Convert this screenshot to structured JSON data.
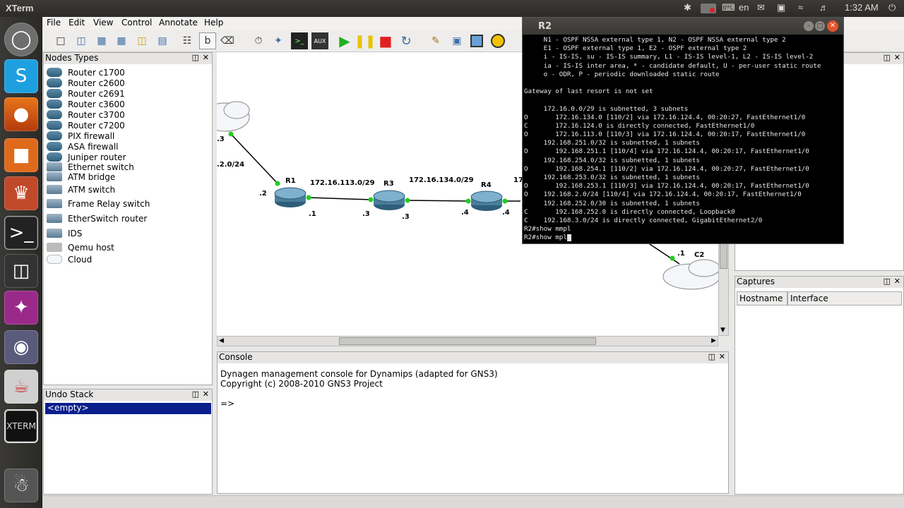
{
  "topbar": {
    "app_title": "XTerm",
    "language": "en",
    "time": "1:32 AM"
  },
  "menu": [
    "File",
    "Edit",
    "View",
    "Control",
    "Annotate",
    "Help"
  ],
  "nodes_panel": {
    "title": "Nodes Types",
    "items": [
      "Router c1700",
      "Router c2600",
      "Router c2691",
      "Router c3600",
      "Router c3700",
      "Router c7200",
      "PIX firewall",
      "ASA firewall",
      "Juniper router",
      "Ethernet switch",
      "ATM bridge",
      "ATM switch",
      "Frame Relay switch",
      "EtherSwitch router",
      "IDS",
      "Qemu host",
      "Cloud"
    ]
  },
  "undo_panel": {
    "title": "Undo Stack",
    "item": "<empty>"
  },
  "topology": {
    "routers": [
      "R1",
      "R3",
      "R4"
    ],
    "cloud": "C2",
    "networks": [
      "172.16.113.0/29",
      "172.16.134.0/29",
      ".2.0/24",
      "17"
    ],
    "iface_labels": [
      ".3",
      ".2",
      ".1",
      ".3",
      ".3",
      ".4",
      ".4",
      ".1"
    ]
  },
  "terminal": {
    "title": "R2",
    "lines": [
      "     N1 - OSPF NSSA external type 1, N2 - OSPF NSSA external type 2",
      "     E1 - OSPF external type 1, E2 - OSPF external type 2",
      "     i - IS-IS, su - IS-IS summary, L1 - IS-IS level-1, L2 - IS-IS level-2",
      "     ia - IS-IS inter area, * - candidate default, U - per-user static route",
      "     o - ODR, P - periodic downloaded static route",
      "",
      "Gateway of last resort is not set",
      "",
      "     172.16.0.0/29 is subnetted, 3 subnets",
      "O       172.16.134.0 [110/2] via 172.16.124.4, 00:20:27, FastEthernet1/0",
      "C       172.16.124.0 is directly connected, FastEthernet1/0",
      "O       172.16.113.0 [110/3] via 172.16.124.4, 00:20:17, FastEthernet1/0",
      "     192.168.251.0/32 is subnetted, 1 subnets",
      "O       192.168.251.1 [110/4] via 172.16.124.4, 00:20:17, FastEthernet1/0",
      "     192.168.254.0/32 is subnetted, 1 subnets",
      "O       192.168.254.1 [110/2] via 172.16.124.4, 00:20:27, FastEthernet1/0",
      "     192.168.253.0/32 is subnetted, 1 subnets",
      "O       192.168.253.1 [110/3] via 172.16.124.4, 00:20:17, FastEthernet1/0",
      "O    192.168.2.0/24 [110/4] via 172.16.124.4, 00:20:17, FastEthernet1/0",
      "     192.168.252.0/30 is subnetted, 1 subnets",
      "C       192.168.252.0 is directly connected, Loopback0",
      "C    192.168.3.0/24 is directly connected, GigabitEthernet2/0",
      "R2#show mmpl",
      "R2#show mpl"
    ]
  },
  "console": {
    "title": "Console",
    "lines": [
      "Dynagen management console for Dynamips (adapted for GNS3)",
      "Copyright (c) 2008-2010 GNS3 Project",
      "",
      "=>"
    ]
  },
  "captures": {
    "title": "Captures",
    "columns": [
      "Hostname",
      "Interface"
    ]
  },
  "colors": {
    "link_dot": "#22cc22",
    "selection": "#0a1f8c",
    "terminal_bg": "#000000"
  }
}
